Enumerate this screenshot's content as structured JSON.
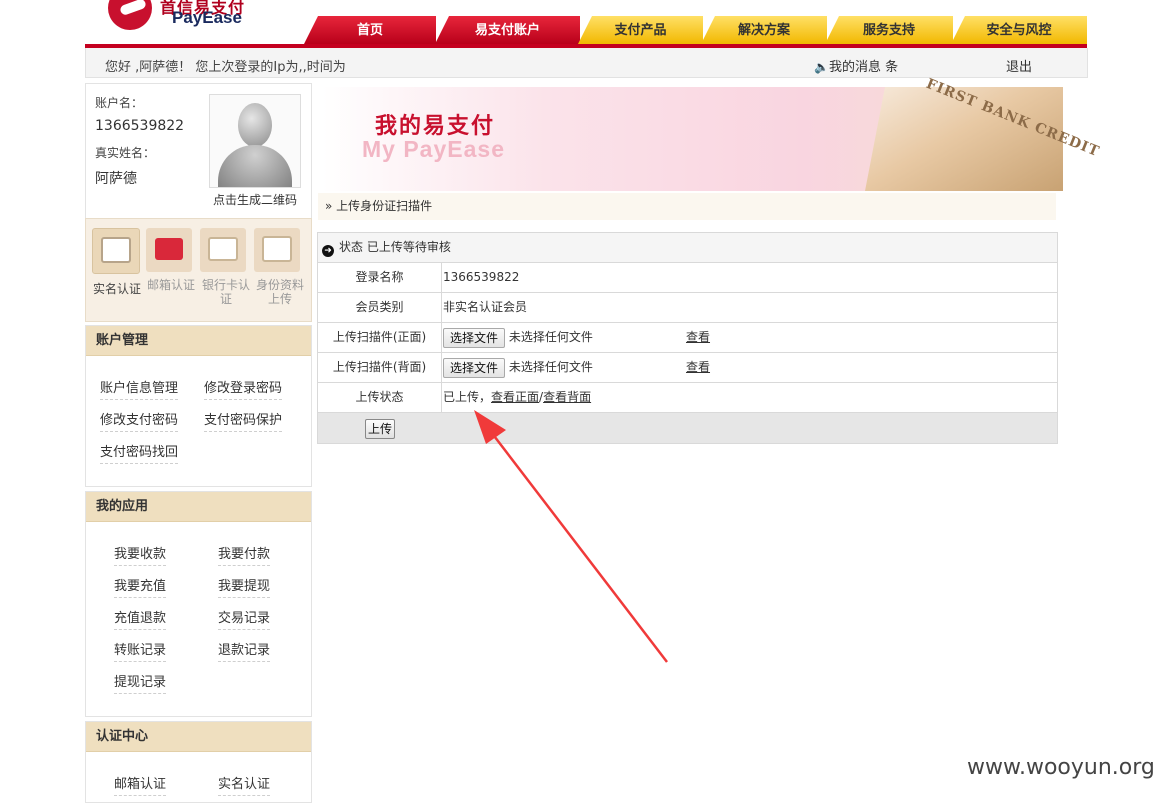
{
  "brand": {
    "name_cn": "首信易支付",
    "name_en": "PayEase"
  },
  "nav": {
    "tabs": [
      {
        "label": "首页",
        "state": "active"
      },
      {
        "label": "易支付账户",
        "state": "active"
      },
      {
        "label": "支付产品",
        "state": "normal"
      },
      {
        "label": "解决方案",
        "state": "normal"
      },
      {
        "label": "服务支持",
        "state": "normal"
      },
      {
        "label": "安全与风控",
        "state": "normal"
      }
    ],
    "colors": {
      "active": "#c4001f",
      "normal": "#f5c400"
    }
  },
  "infobar": {
    "greeting": "您好 ,阿萨德！  您上次登录的Ip为,,时间为",
    "messages": "我的消息 条",
    "logout": "退出"
  },
  "profile": {
    "account_label": "账户名：",
    "account_value": "1366539822",
    "realname_label": "真实姓名：",
    "realname_value": "阿萨德",
    "qr_link": "点击生成二维码"
  },
  "auth_items": [
    {
      "label": "实名认证",
      "icon": "id-card-icon",
      "active": true
    },
    {
      "label": "邮箱认证",
      "icon": "mail-icon",
      "active": false
    },
    {
      "label": "银行卡认证",
      "icon": "bank-card-icon",
      "active": false
    },
    {
      "label": "身份资料上传",
      "icon": "upload-box-icon",
      "active": false
    }
  ],
  "account_mgmt": {
    "title": "账户管理",
    "links": [
      "账户信息管理",
      "修改登录密码",
      "修改支付密码",
      "支付密码保护",
      "支付密码找回"
    ]
  },
  "my_apps": {
    "title": "我的应用",
    "links": [
      "我要收款",
      "我要付款",
      "我要充值",
      "我要提现",
      "充值退款",
      "交易记录",
      "转账记录",
      "退款记录",
      "提现记录"
    ]
  },
  "cert_center": {
    "title": "认证中心",
    "links": [
      "邮箱认证",
      "实名认证"
    ]
  },
  "banner": {
    "title_cn": "我的易支付",
    "title_en": "My  PayEase",
    "card_text": "FIRST BANK CREDIT"
  },
  "breadcrumb": "» 上传身份证扫描件",
  "form": {
    "status": "状态 已上传等待审核",
    "login_name_label": "登录名称",
    "login_name_value": "1366539822",
    "member_type_label": "会员类别",
    "member_type_value": "非实名认证会员",
    "front_label": "上传扫描件(正面)",
    "back_label": "上传扫描件(背面)",
    "choose_file": "选择文件",
    "no_file": "未选择任何文件",
    "view": "查看",
    "upload_status_label": "上传状态",
    "upload_status_prefix": "已上传，",
    "view_front": "查看正面",
    "slash": "/",
    "view_back": "查看背面",
    "submit": "上传"
  },
  "watermark": "www.wooyun.org"
}
